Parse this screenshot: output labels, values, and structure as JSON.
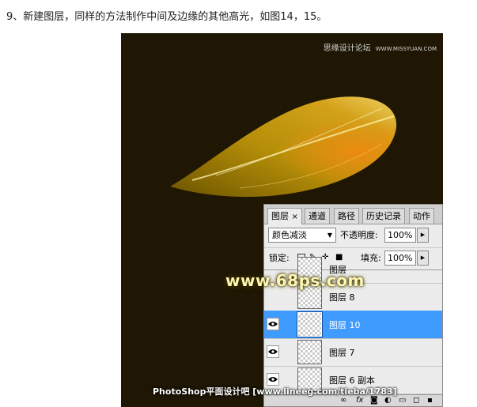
{
  "heading": "9、新建图层，同样的方法制作中间及边缘的其他高光，如图14，15。",
  "canvas": {
    "watermark_top": "思缘设计论坛",
    "watermark_top_url": "WWW.MISSYUAN.COM",
    "watermark_mid": "www.68ps.com",
    "watermark_bottom": "PhotoShop平面设计吧 [www.lineeg.com/tieba/1783]"
  },
  "panel": {
    "tabs": [
      {
        "label": "图层"
      },
      {
        "label": "×"
      },
      {
        "label": "通道"
      },
      {
        "label": "路径"
      },
      {
        "label": "历史记录"
      },
      {
        "label": "动作"
      }
    ],
    "blend_mode": "颜色减淡",
    "opacity_label": "不透明度:",
    "opacity_value": "100%",
    "lock_label": "锁定:",
    "fill_label": "填充:",
    "fill_value": "100%",
    "layers": [
      {
        "name": "图层",
        "visible": false,
        "selected": false
      },
      {
        "name": "图层 8",
        "visible": false,
        "selected": false
      },
      {
        "name": "图层 10",
        "visible": true,
        "selected": true
      },
      {
        "name": "图层 7",
        "visible": true,
        "selected": false
      },
      {
        "name": "图层 6 副本",
        "visible": true,
        "selected": false
      }
    ],
    "bottom_icons": [
      "link-icon",
      "fx-icon",
      "mask-icon",
      "adjustment-icon",
      "folder-icon",
      "new-layer-icon",
      "trash-icon"
    ]
  }
}
